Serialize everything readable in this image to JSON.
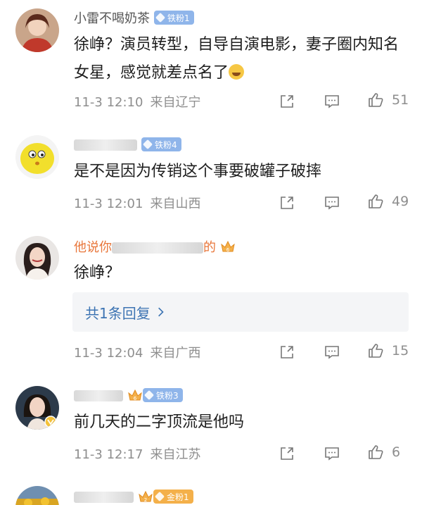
{
  "comments": [
    {
      "username": "小雷不喝奶茶",
      "badge": "铁粉1",
      "text": "徐峥？演员转型，自导自演电影，妻子圈内知名女星，感觉就差点名了",
      "time": "11-3 12:10",
      "location": "来自辽宁",
      "likes": "51"
    },
    {
      "username": "",
      "badge": "铁粉4",
      "text": "是不是因为传销这个事要破罐子破摔",
      "time": "11-3 12:01",
      "location": "来自山西",
      "likes": "49"
    },
    {
      "username_prefix": "他说你",
      "username_suffix": "的",
      "badge": "",
      "text": "徐峥？",
      "replies": "共1条回复",
      "time": "11-3 12:04",
      "location": "来自广西",
      "likes": "15"
    },
    {
      "username": "",
      "badge": "铁粉3",
      "text": "前几天的二字顶流是他吗",
      "time": "11-3 12:17",
      "location": "来自江苏",
      "likes": "6"
    },
    {
      "username": "",
      "badge": "金粉1"
    }
  ],
  "icons": {
    "share": "share-icon",
    "reply": "comment-icon",
    "like": "thumbs-up-icon",
    "chevron": "chevron-right-icon"
  },
  "colors": {
    "vip_name": "#e8763a",
    "link": "#3d74b3",
    "meta": "#8e8e8e",
    "iron_badge": "#8fb5ea",
    "gold_badge": "#f4b04a"
  }
}
